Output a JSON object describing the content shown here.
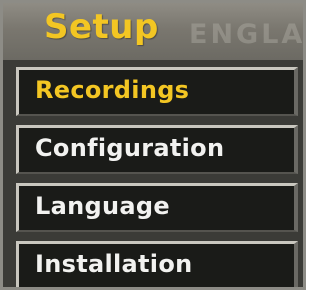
{
  "menu": {
    "title": "Setup",
    "background_text": "ENGLA",
    "selected_index": 0,
    "items": [
      {
        "label": "Recordings"
      },
      {
        "label": "Configuration"
      },
      {
        "label": "Language"
      },
      {
        "label": "Installation"
      }
    ]
  },
  "colors": {
    "highlight": "#f3c623",
    "item_text": "#f2f2f0",
    "item_background": "#1a1b18",
    "panel_background": "#3b3b37"
  }
}
